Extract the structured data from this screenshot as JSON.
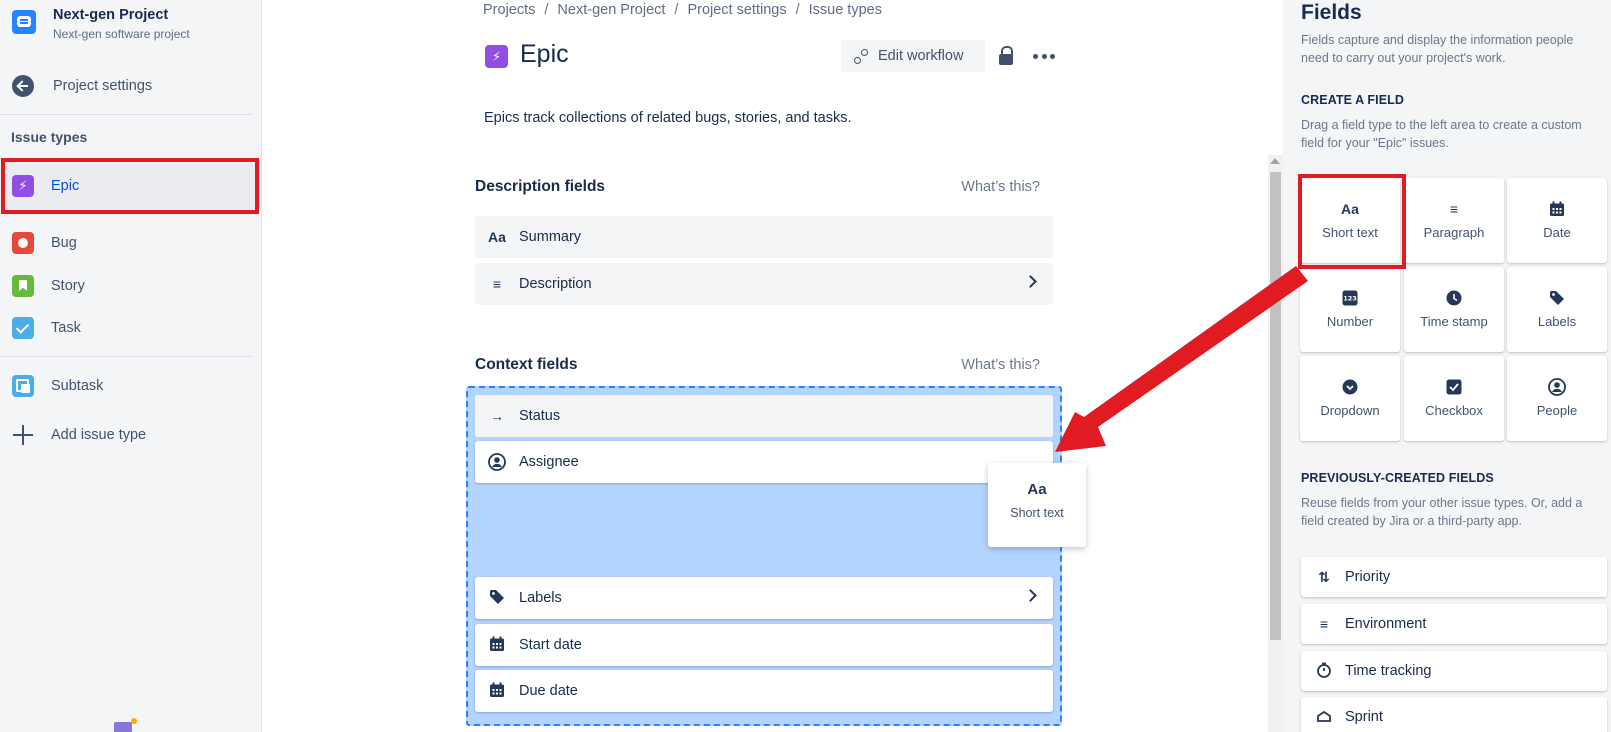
{
  "sidebar": {
    "project_name": "Next-gen Project",
    "project_type": "Next-gen software project",
    "back_label": "Project settings",
    "section_title": "Issue types",
    "items": [
      {
        "label": "Epic"
      },
      {
        "label": "Bug"
      },
      {
        "label": "Story"
      },
      {
        "label": "Task"
      },
      {
        "label": "Subtask"
      }
    ],
    "add_label": "Add issue type"
  },
  "breadcrumb": [
    "Projects",
    "Next-gen Project",
    "Project settings",
    "Issue types"
  ],
  "header": {
    "title": "Epic",
    "edit_workflow_label": "Edit workflow",
    "description": "Epics track collections of related bugs, stories, and tasks."
  },
  "description_fields": {
    "title": "Description fields",
    "help": "What’s this?",
    "fields": [
      {
        "label": "Summary",
        "icon": "Aa"
      },
      {
        "label": "Description",
        "icon": "paragraph-icon"
      }
    ]
  },
  "context_fields": {
    "title": "Context fields",
    "help": "What’s this?",
    "fields": [
      {
        "label": "Status",
        "icon": "arrow-right-icon"
      },
      {
        "label": "Assignee",
        "icon": "person-icon"
      },
      {
        "label": "Labels",
        "icon": "tag-icon"
      },
      {
        "label": "Start date",
        "icon": "calendar-icon"
      },
      {
        "label": "Due date",
        "icon": "calendar-icon"
      }
    ]
  },
  "drag_card": {
    "icon": "Aa",
    "label": "Short text"
  },
  "panel": {
    "title": "Fields",
    "intro": "Fields capture and display the information people need to carry out your project's work.",
    "create_heading": "CREATE A FIELD",
    "create_text": "Drag a field type to the left area to create a custom field for your \"Epic\" issues.",
    "field_types": [
      {
        "label": "Short text",
        "icon": "Aa"
      },
      {
        "label": "Paragraph",
        "icon": "paragraph-icon"
      },
      {
        "label": "Date",
        "icon": "calendar-icon"
      },
      {
        "label": "Number",
        "icon": "123"
      },
      {
        "label": "Time stamp",
        "icon": "clock-icon"
      },
      {
        "label": "Labels",
        "icon": "tag-icon"
      },
      {
        "label": "Dropdown",
        "icon": "chevron-circle-icon"
      },
      {
        "label": "Checkbox",
        "icon": "checkbox-icon"
      },
      {
        "label": "People",
        "icon": "person-icon"
      }
    ],
    "previous_heading": "PREVIOUSLY-CREATED FIELDS",
    "previous_text": "Reuse fields from your other issue types. Or, add a field created by Jira or a third-party app.",
    "previous_fields": [
      {
        "label": "Priority",
        "icon": "sort-icon"
      },
      {
        "label": "Environment",
        "icon": "paragraph-icon"
      },
      {
        "label": "Time tracking",
        "icon": "stopwatch-icon"
      },
      {
        "label": "Sprint",
        "icon": "sprint-icon"
      }
    ]
  },
  "colors": {
    "epic": "#904ee2",
    "bug": "#e5493a",
    "story": "#63ba3c",
    "task": "#4bade8",
    "annotation_red": "#e01b22",
    "drop_zone": "#b3d4ff"
  }
}
